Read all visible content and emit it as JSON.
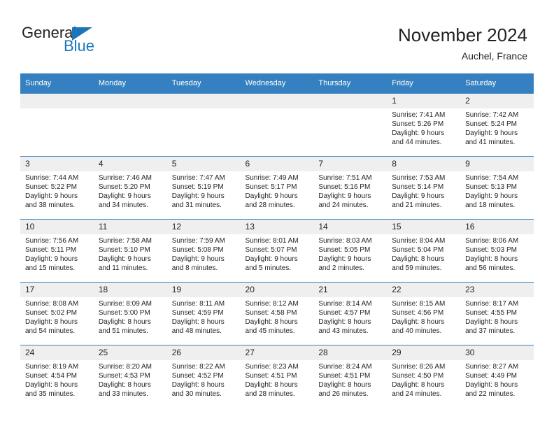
{
  "brand": {
    "name_part1": "General",
    "name_part2": "Blue",
    "triangle_color": "#1b75bb"
  },
  "header": {
    "title": "November 2024",
    "subtitle": "Auchel, France"
  },
  "theme": {
    "header_bg": "#3580c0",
    "daynum_bg": "#efefef",
    "text": "#231f20"
  },
  "weekday_headers": [
    "Sunday",
    "Monday",
    "Tuesday",
    "Wednesday",
    "Thursday",
    "Friday",
    "Saturday"
  ],
  "weeks": [
    [
      {
        "day": "",
        "blank": true
      },
      {
        "day": "",
        "blank": true
      },
      {
        "day": "",
        "blank": true
      },
      {
        "day": "",
        "blank": true
      },
      {
        "day": "",
        "blank": true
      },
      {
        "day": "1",
        "sunrise": "Sunrise: 7:41 AM",
        "sunset": "Sunset: 5:26 PM",
        "daylight_1": "Daylight: 9 hours",
        "daylight_2": "and 44 minutes."
      },
      {
        "day": "2",
        "sunrise": "Sunrise: 7:42 AM",
        "sunset": "Sunset: 5:24 PM",
        "daylight_1": "Daylight: 9 hours",
        "daylight_2": "and 41 minutes."
      }
    ],
    [
      {
        "day": "3",
        "sunrise": "Sunrise: 7:44 AM",
        "sunset": "Sunset: 5:22 PM",
        "daylight_1": "Daylight: 9 hours",
        "daylight_2": "and 38 minutes."
      },
      {
        "day": "4",
        "sunrise": "Sunrise: 7:46 AM",
        "sunset": "Sunset: 5:20 PM",
        "daylight_1": "Daylight: 9 hours",
        "daylight_2": "and 34 minutes."
      },
      {
        "day": "5",
        "sunrise": "Sunrise: 7:47 AM",
        "sunset": "Sunset: 5:19 PM",
        "daylight_1": "Daylight: 9 hours",
        "daylight_2": "and 31 minutes."
      },
      {
        "day": "6",
        "sunrise": "Sunrise: 7:49 AM",
        "sunset": "Sunset: 5:17 PM",
        "daylight_1": "Daylight: 9 hours",
        "daylight_2": "and 28 minutes."
      },
      {
        "day": "7",
        "sunrise": "Sunrise: 7:51 AM",
        "sunset": "Sunset: 5:16 PM",
        "daylight_1": "Daylight: 9 hours",
        "daylight_2": "and 24 minutes."
      },
      {
        "day": "8",
        "sunrise": "Sunrise: 7:53 AM",
        "sunset": "Sunset: 5:14 PM",
        "daylight_1": "Daylight: 9 hours",
        "daylight_2": "and 21 minutes."
      },
      {
        "day": "9",
        "sunrise": "Sunrise: 7:54 AM",
        "sunset": "Sunset: 5:13 PM",
        "daylight_1": "Daylight: 9 hours",
        "daylight_2": "and 18 minutes."
      }
    ],
    [
      {
        "day": "10",
        "sunrise": "Sunrise: 7:56 AM",
        "sunset": "Sunset: 5:11 PM",
        "daylight_1": "Daylight: 9 hours",
        "daylight_2": "and 15 minutes."
      },
      {
        "day": "11",
        "sunrise": "Sunrise: 7:58 AM",
        "sunset": "Sunset: 5:10 PM",
        "daylight_1": "Daylight: 9 hours",
        "daylight_2": "and 11 minutes."
      },
      {
        "day": "12",
        "sunrise": "Sunrise: 7:59 AM",
        "sunset": "Sunset: 5:08 PM",
        "daylight_1": "Daylight: 9 hours",
        "daylight_2": "and 8 minutes."
      },
      {
        "day": "13",
        "sunrise": "Sunrise: 8:01 AM",
        "sunset": "Sunset: 5:07 PM",
        "daylight_1": "Daylight: 9 hours",
        "daylight_2": "and 5 minutes."
      },
      {
        "day": "14",
        "sunrise": "Sunrise: 8:03 AM",
        "sunset": "Sunset: 5:05 PM",
        "daylight_1": "Daylight: 9 hours",
        "daylight_2": "and 2 minutes."
      },
      {
        "day": "15",
        "sunrise": "Sunrise: 8:04 AM",
        "sunset": "Sunset: 5:04 PM",
        "daylight_1": "Daylight: 8 hours",
        "daylight_2": "and 59 minutes."
      },
      {
        "day": "16",
        "sunrise": "Sunrise: 8:06 AM",
        "sunset": "Sunset: 5:03 PM",
        "daylight_1": "Daylight: 8 hours",
        "daylight_2": "and 56 minutes."
      }
    ],
    [
      {
        "day": "17",
        "sunrise": "Sunrise: 8:08 AM",
        "sunset": "Sunset: 5:02 PM",
        "daylight_1": "Daylight: 8 hours",
        "daylight_2": "and 54 minutes."
      },
      {
        "day": "18",
        "sunrise": "Sunrise: 8:09 AM",
        "sunset": "Sunset: 5:00 PM",
        "daylight_1": "Daylight: 8 hours",
        "daylight_2": "and 51 minutes."
      },
      {
        "day": "19",
        "sunrise": "Sunrise: 8:11 AM",
        "sunset": "Sunset: 4:59 PM",
        "daylight_1": "Daylight: 8 hours",
        "daylight_2": "and 48 minutes."
      },
      {
        "day": "20",
        "sunrise": "Sunrise: 8:12 AM",
        "sunset": "Sunset: 4:58 PM",
        "daylight_1": "Daylight: 8 hours",
        "daylight_2": "and 45 minutes."
      },
      {
        "day": "21",
        "sunrise": "Sunrise: 8:14 AM",
        "sunset": "Sunset: 4:57 PM",
        "daylight_1": "Daylight: 8 hours",
        "daylight_2": "and 43 minutes."
      },
      {
        "day": "22",
        "sunrise": "Sunrise: 8:15 AM",
        "sunset": "Sunset: 4:56 PM",
        "daylight_1": "Daylight: 8 hours",
        "daylight_2": "and 40 minutes."
      },
      {
        "day": "23",
        "sunrise": "Sunrise: 8:17 AM",
        "sunset": "Sunset: 4:55 PM",
        "daylight_1": "Daylight: 8 hours",
        "daylight_2": "and 37 minutes."
      }
    ],
    [
      {
        "day": "24",
        "sunrise": "Sunrise: 8:19 AM",
        "sunset": "Sunset: 4:54 PM",
        "daylight_1": "Daylight: 8 hours",
        "daylight_2": "and 35 minutes."
      },
      {
        "day": "25",
        "sunrise": "Sunrise: 8:20 AM",
        "sunset": "Sunset: 4:53 PM",
        "daylight_1": "Daylight: 8 hours",
        "daylight_2": "and 33 minutes."
      },
      {
        "day": "26",
        "sunrise": "Sunrise: 8:22 AM",
        "sunset": "Sunset: 4:52 PM",
        "daylight_1": "Daylight: 8 hours",
        "daylight_2": "and 30 minutes."
      },
      {
        "day": "27",
        "sunrise": "Sunrise: 8:23 AM",
        "sunset": "Sunset: 4:51 PM",
        "daylight_1": "Daylight: 8 hours",
        "daylight_2": "and 28 minutes."
      },
      {
        "day": "28",
        "sunrise": "Sunrise: 8:24 AM",
        "sunset": "Sunset: 4:51 PM",
        "daylight_1": "Daylight: 8 hours",
        "daylight_2": "and 26 minutes."
      },
      {
        "day": "29",
        "sunrise": "Sunrise: 8:26 AM",
        "sunset": "Sunset: 4:50 PM",
        "daylight_1": "Daylight: 8 hours",
        "daylight_2": "and 24 minutes."
      },
      {
        "day": "30",
        "sunrise": "Sunrise: 8:27 AM",
        "sunset": "Sunset: 4:49 PM",
        "daylight_1": "Daylight: 8 hours",
        "daylight_2": "and 22 minutes."
      }
    ]
  ]
}
